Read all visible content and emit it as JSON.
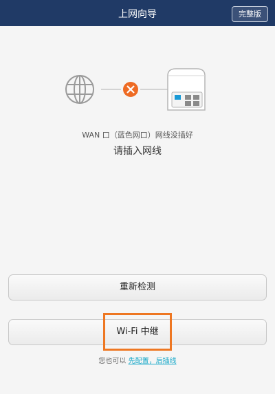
{
  "header": {
    "title": "上网向导",
    "full_version_label": "完整版"
  },
  "diagram": {
    "internet_icon": "globe-icon",
    "status_icon": "error-x-icon",
    "router_icon": "router-icon",
    "status_color": "#ee6b24",
    "highlight_port_color": "#1a9ad6"
  },
  "status": {
    "message": "WAN 口（蓝色网口）网线没插好",
    "prompt": "请插入网线"
  },
  "actions": {
    "retest_label": "重新检测",
    "relay_label": "Wi-Fi 中继"
  },
  "alternative": {
    "prefix": "您也可以",
    "link": "先配置，后插线"
  },
  "colors": {
    "header_bg": "#203a66",
    "highlight": "#ee7722",
    "link": "#19a9c9"
  }
}
